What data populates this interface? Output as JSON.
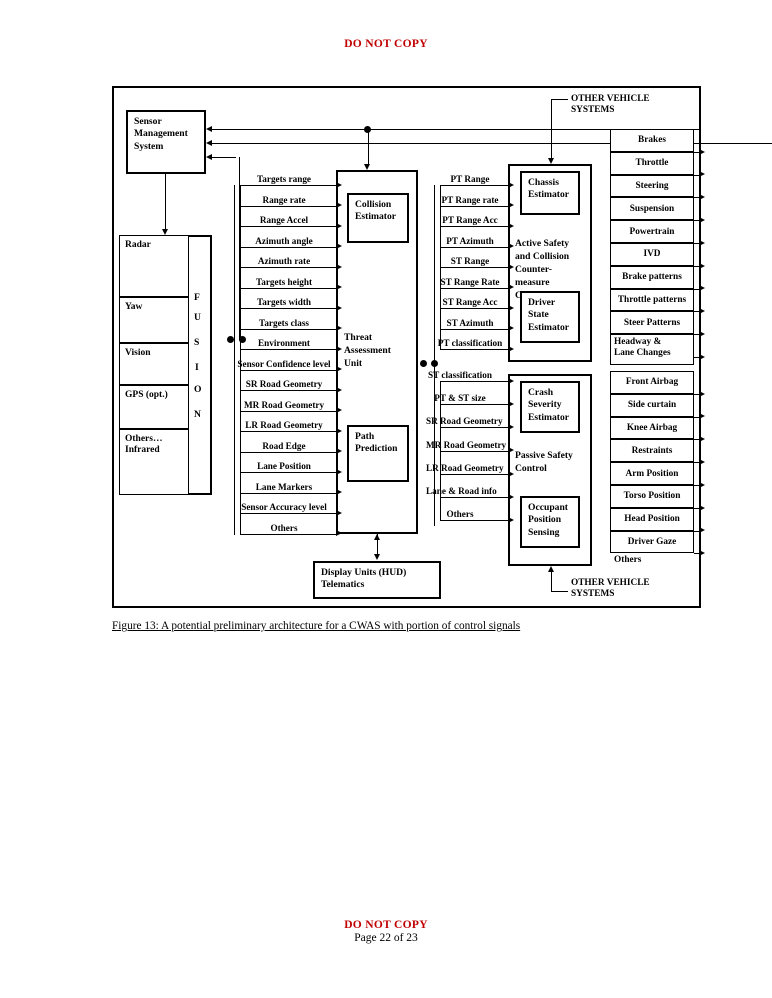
{
  "page": {
    "watermark": "DO NOT COPY",
    "footer_watermark": "DO NOT COPY",
    "page_number": "Page 22 of 23"
  },
  "figure": {
    "caption": "Figure 13: A potential preliminary architecture for a CWAS with portion of control signals",
    "blocks": {
      "sensor_management": "Sensor\nManagement\nSystem",
      "sensor_management_lines": [
        "Sensor",
        "Management",
        "System"
      ],
      "threat_assessment": [
        "Threat",
        "Assessment",
        "Unit"
      ],
      "collision_estimator": [
        "Collision",
        "Estimator"
      ],
      "path_prediction": [
        "Path",
        "Prediction"
      ],
      "active_safety": [
        "Active Safety",
        "and Collision",
        "Counter-",
        "measure",
        "Control"
      ],
      "chassis_estimator": [
        "Chassis",
        "Estimator"
      ],
      "driver_state_estimator": [
        "Driver",
        "State",
        "Estimator"
      ],
      "passive_safety": [
        "Passive Safety",
        "Control"
      ],
      "crash_severity_estimator": [
        "Crash",
        "Severity",
        "Estimator"
      ],
      "occupant_position_sensing": [
        "Occupant",
        "Position",
        "Sensing"
      ],
      "display_units": [
        "Display Units (HUD)",
        "Telematics"
      ]
    },
    "annotations": {
      "other_vehicle_systems_top": [
        "OTHER VEHICLE",
        "SYSTEMS"
      ],
      "other_vehicle_systems_bottom": [
        "OTHER VEHICLE",
        "SYSTEMS"
      ],
      "fusion_letters": [
        "F",
        "U",
        "S",
        "I",
        "O",
        "N"
      ]
    },
    "sensors": [
      "Radar",
      "Yaw",
      "Vision",
      "GPS (opt.)",
      "Others…\nInfrared"
    ],
    "sensor_labels": [
      "Radar",
      "Yaw",
      "Vision",
      "GPS (opt.)",
      "Others…",
      "Infrared"
    ],
    "sensor_to_tau_signals": [
      "Targets range",
      "Range rate",
      "Range Accel",
      "Azimuth angle",
      "Azimuth rate",
      "Targets height",
      "Targets width",
      "Targets class",
      "Environment",
      "Sensor Confidence level",
      "SR Road Geometry",
      "MR Road Geometry",
      "LR Road Geometry",
      "Road Edge",
      "Lane Position",
      "Lane Markers",
      "Sensor Accuracy level",
      "Others"
    ],
    "tau_to_active_safety_signals": [
      "PT Range",
      "PT Range rate",
      "PT Range Acc",
      "PT Azimuth",
      "ST Range",
      "ST Range Rate",
      "ST Range Acc",
      "ST Azimuth",
      "PT classification"
    ],
    "tau_to_passive_safety_signals": [
      "ST classification",
      "PT & ST size",
      "SR Road Geometry",
      "MR Road Geometry",
      "LR Road Geometry",
      "Lane & Road info",
      "Others"
    ],
    "active_safety_outputs": [
      "Brakes",
      "Throttle",
      "Steering",
      "Suspension",
      "Powertrain",
      "IVD",
      "Brake patterns",
      "Throttle patterns",
      "Steer Patterns",
      "Headway &\nLane Changes"
    ],
    "active_safety_outputs_flat": [
      "Brakes",
      "Throttle",
      "Steering",
      "Suspension",
      "Powertrain",
      "IVD",
      "Brake patterns",
      "Throttle patterns",
      "Steer Patterns",
      "Headway &",
      "Lane Changes"
    ],
    "passive_safety_outputs": [
      "Front Airbag",
      "Side curtain",
      "Knee Airbag",
      "Restraints",
      "Arm Position",
      "Torso Position",
      "Head Position",
      "Driver Gaze"
    ],
    "passive_safety_outputs_trailing": "Others"
  }
}
